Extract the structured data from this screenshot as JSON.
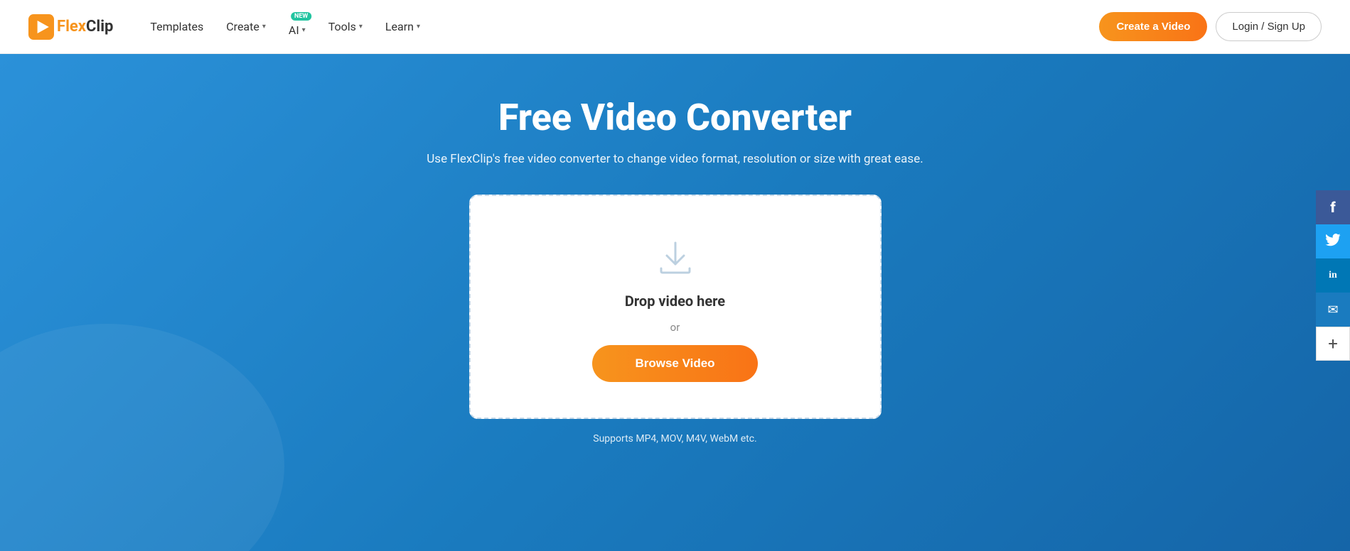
{
  "navbar": {
    "logo_text_flex": "Flex",
    "logo_text_clip": "Clip",
    "nav_items": [
      {
        "id": "templates",
        "label": "Templates",
        "has_dropdown": false
      },
      {
        "id": "create",
        "label": "Create",
        "has_dropdown": true
      },
      {
        "id": "ai",
        "label": "AI",
        "has_dropdown": true,
        "badge": "NEW"
      },
      {
        "id": "tools",
        "label": "Tools",
        "has_dropdown": true
      },
      {
        "id": "learn",
        "label": "Learn",
        "has_dropdown": true
      }
    ],
    "btn_create_label": "Create a Video",
    "btn_login_label": "Login / Sign Up"
  },
  "hero": {
    "title": "Free Video Converter",
    "subtitle": "Use FlexClip's free video converter to change video format, resolution or size with great ease.",
    "drop_text": "Drop video here",
    "drop_or": "or",
    "btn_browse_label": "Browse Video",
    "supports_text": "Supports MP4, MOV, M4V, WebM etc."
  },
  "social": {
    "items": [
      {
        "id": "facebook",
        "icon": "f",
        "label": "Facebook"
      },
      {
        "id": "twitter",
        "icon": "🐦",
        "label": "Twitter"
      },
      {
        "id": "linkedin",
        "icon": "in",
        "label": "LinkedIn"
      },
      {
        "id": "email",
        "icon": "✉",
        "label": "Email"
      },
      {
        "id": "more",
        "icon": "+",
        "label": "More"
      }
    ]
  }
}
